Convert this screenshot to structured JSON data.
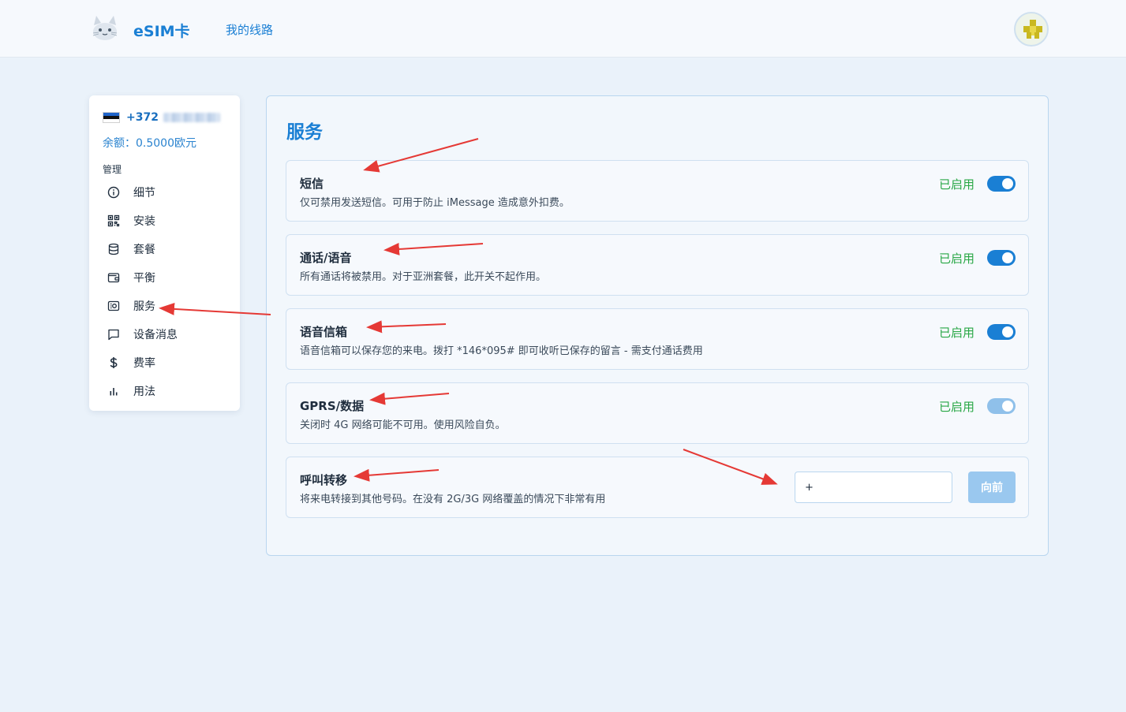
{
  "header": {
    "brand": "eSIM卡",
    "nav_link": "我的线路",
    "logo_icon": "cat-logo-icon",
    "avatar_icon": "pixel-avatar-icon"
  },
  "sidebar": {
    "phone": "+372",
    "balance": "余额：0.5000欧元",
    "manage_label": "管理",
    "items": [
      {
        "label": "细节",
        "icon": "info-icon"
      },
      {
        "label": "安装",
        "icon": "qr-code-icon"
      },
      {
        "label": "套餐",
        "icon": "database-icon"
      },
      {
        "label": "平衡",
        "icon": "wallet-icon"
      },
      {
        "label": "服务",
        "icon": "service-icon"
      },
      {
        "label": "设备消息",
        "icon": "message-icon"
      },
      {
        "label": "费率",
        "icon": "dollar-icon"
      },
      {
        "label": "用法",
        "icon": "bar-chart-icon"
      }
    ]
  },
  "main": {
    "title": "服务",
    "services": [
      {
        "title": "短信",
        "desc": "仅可禁用发送短信。可用于防止 iMessage 造成意外扣费。",
        "status": "已启用",
        "enabled": true
      },
      {
        "title": "通话/语音",
        "desc": "所有通话将被禁用。对于亚洲套餐，此开关不起作用。",
        "status": "已启用",
        "enabled": true
      },
      {
        "title": "语音信箱",
        "desc": "语音信箱可以保存您的来电。拨打 *146*095# 即可收听已保存的留言 - 需支付通话费用",
        "status": "已启用",
        "enabled": true
      },
      {
        "title": "GPRS/数据",
        "desc": "关闭时 4G 网络可能不可用。使用风险自负。",
        "status": "已启用",
        "enabled": true
      }
    ],
    "forwarding": {
      "title": "呼叫转移",
      "desc": "将来电转接到其他号码。在没有 2G/3G 网络覆盖的情况下非常有用",
      "input_value": "+",
      "button_label": "向前"
    }
  },
  "colors": {
    "accent": "#1a7fd4",
    "enabled_text": "#28a745",
    "annotation_arrow": "#e53935"
  }
}
